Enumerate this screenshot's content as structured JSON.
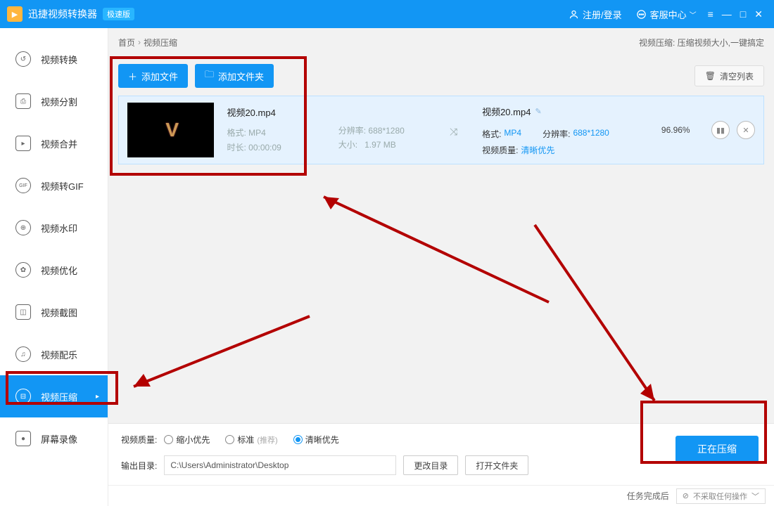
{
  "titlebar": {
    "app_name": "迅捷视频转换器",
    "badge": "极速版",
    "login": "注册/登录",
    "support": "客服中心"
  },
  "sidebar": {
    "items": [
      {
        "label": "视频转换",
        "icon": "↺"
      },
      {
        "label": "视频分割",
        "icon": "⎙"
      },
      {
        "label": "视频合并",
        "icon": "▸"
      },
      {
        "label": "视频转GIF",
        "icon": "GIF"
      },
      {
        "label": "视频水印",
        "icon": "⊕"
      },
      {
        "label": "视频优化",
        "icon": "✿"
      },
      {
        "label": "视频截图",
        "icon": "◫"
      },
      {
        "label": "视频配乐",
        "icon": "♫"
      },
      {
        "label": "视频压缩",
        "icon": "⊟",
        "active": true
      },
      {
        "label": "屏幕录像",
        "icon": "●"
      }
    ]
  },
  "breadcrumb": {
    "root": "首页",
    "current": "视频压缩",
    "tip_label": "视频压缩:",
    "tip_text": "压缩视频大小,一键搞定"
  },
  "toolbar": {
    "add_file": "添加文件",
    "add_folder": "添加文件夹",
    "clear_list": "清空列表"
  },
  "file": {
    "src_name": "视频20.mp4",
    "format_label": "格式:",
    "format": "MP4",
    "duration_label": "时长:",
    "duration": "00:00:09",
    "resolution_label": "分辨率:",
    "resolution": "688*1280",
    "size_label": "大小:",
    "size": "1.97 MB",
    "out_name": "视频20.mp4",
    "out_format": "MP4",
    "out_resolution": "688*1280",
    "quality_label": "视频质量:",
    "quality_val": "清晰优先",
    "progress": "96.96%"
  },
  "bottom": {
    "quality_label": "视频质量:",
    "opt_small": "缩小优先",
    "opt_standard": "标准",
    "opt_standard_hint": "(推荐)",
    "opt_clear": "清晰优先",
    "outdir_label": "输出目录:",
    "outdir_value": "C:\\Users\\Administrator\\Desktop",
    "change_dir": "更改目录",
    "open_folder": "打开文件夹",
    "compress_btn": "正在压缩"
  },
  "footer": {
    "after_label": "任务完成后",
    "dd_value": "不采取任何操作"
  }
}
